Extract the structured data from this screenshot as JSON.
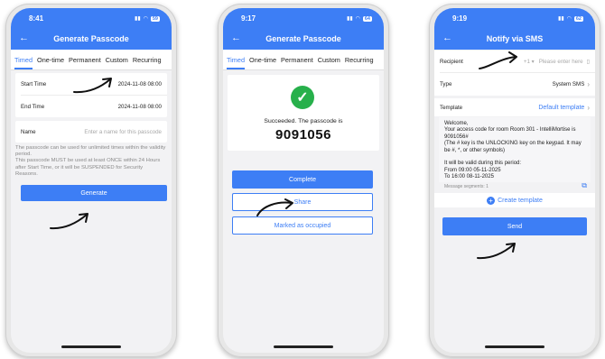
{
  "phone1": {
    "status_time": "8:41",
    "battery": "59",
    "title": "Generate Passcode",
    "tabs": [
      "Timed",
      "One-time",
      "Permanent",
      "Custom",
      "Recurring"
    ],
    "start_time_label": "Start Time",
    "start_time_value": "2024-11-08 08:00",
    "end_time_label": "End Time",
    "end_time_value": "2024-11-08 08:00",
    "name_label": "Name",
    "name_placeholder": "Enter a name for this passcode",
    "hint": "The passcode can be used for unlimited times within the validity period.\nThis passcode MUST be used at least ONCE within 24 Hours after Start Time, or it will be SUSPENDED for Security Reasons.",
    "generate_label": "Generate"
  },
  "phone2": {
    "status_time": "9:17",
    "battery": "64",
    "title": "Generate Passcode",
    "tabs": [
      "Timed",
      "One-time",
      "Permanent",
      "Custom",
      "Recurring"
    ],
    "success_text": "Succeeded. The passcode is",
    "passcode": "9091056",
    "complete_label": "Complete",
    "share_label": "Share",
    "occupied_label": "Marked as occupied"
  },
  "phone3": {
    "status_time": "9:19",
    "battery": "62",
    "title": "Notify via SMS",
    "recipient_label": "Recipient",
    "country_code": "+1",
    "recipient_placeholder": "Please enter here",
    "type_label": "Type",
    "type_value": "System SMS",
    "template_label": "Template",
    "template_value": "Default template",
    "message": "Welcome,\nYour access code for room Room 301 - IntelliMortise is 9091056#\n(The # key is the UNLOCKING key on the keypad. It may be #, *, or other symbols)\n\nIt will be valid during this period:\nFrom 09:00 05-11-2025\nTo 16:00 08-11-2025",
    "segments": "Message segments: 1",
    "create_template_label": "Create template",
    "send_label": "Send"
  }
}
